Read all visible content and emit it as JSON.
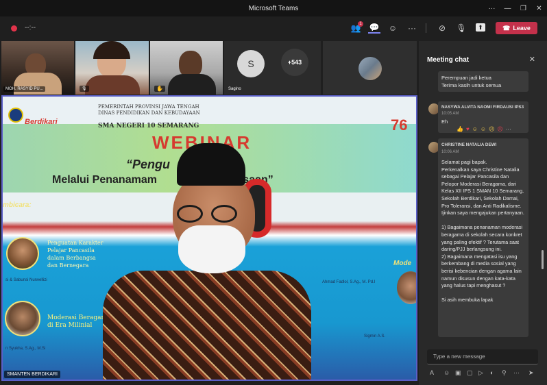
{
  "window": {
    "title": "Microsoft Teams"
  },
  "toolbar": {
    "timer": "--:--",
    "participants_badge": "1",
    "leave_label": "Leave"
  },
  "tiles": [
    {
      "name": "MOH. RASYID PU..."
    },
    {
      "name": ""
    },
    {
      "name": ""
    },
    {
      "initial": "S",
      "name": "Sagino"
    },
    {
      "overflow": "+543"
    }
  ],
  "stage": {
    "pip_name": "SMANTEN BERDIKARI",
    "poster": {
      "header": "PEMERINTAH PROVINSI JAWA TENGAH\nDINAS PENDIDIKAN DAN KEBUDAYAAN",
      "school": "SMA NEGERI 10 SEMARANG",
      "berdikari": "Berdikari",
      "webinar": "WEBINAR",
      "title_line1": "“Pengu         rakter",
      "title_line2": "Melalui Penanamam           ai Kebangsaan”",
      "anniversary": "76",
      "pembicara": "mbicara:",
      "topic1": "Penguatan Karakter\nPelajar Pancasila\ndalam Berbangsa\ndan Bernegara",
      "speaker1": "si & Sabunsi Nurwellizi",
      "topic2": "Moderasi Beragam\ndi Era Milinial",
      "speaker2": "n Syukha, S.Ag., M.Si",
      "moderator": "Mode",
      "mod_name1": "Ahmad Fadlol, S.Ag., M. Pd.I",
      "mod_name2": "Sigmin A.S."
    }
  },
  "chat": {
    "title": "Meeting chat",
    "messages": [
      {
        "text": "Perempuan jadi ketua\nTerima kasih untuk semua"
      },
      {
        "name": "NASYWA ALVITA NAOMI FIRDAUSI IPS3",
        "time": "10:05 AM",
        "text": "Eh"
      },
      {
        "name": "CHRISTINE NATALIA DEWI",
        "time": "10:06 AM",
        "text": "Selamat pagi bapak.\nPerkenalkan saya Christine Natalia sebagai Pelajar Pancasila dan Pelopor Moderasi Beragama, dari Kelas XII IPS 1 SMAN 10 Semarang, Sekolah Berdikari, Sekolah Damai, Pro Toleransi, dan Anti Radikalisme. Ijinkan saya mengajukan pertanyaan.\n\n1) Bagaimana penanaman moderasi beragama di sekolah secara konkret yang paling efektif ? Terutama saat daring/PJJ berlangsung ini.\n2) Bagaimana mengatasi isu yang berkembang di media sosial yang berisi kebencian dengan agama lain namun disusun dengan kata-kata yang halus tapi menghasut ?\n\nSi asih membuka lapak"
      }
    ],
    "compose_placeholder": "Type a new message"
  }
}
